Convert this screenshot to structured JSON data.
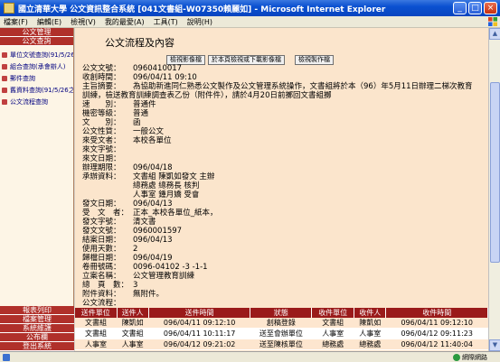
{
  "window": {
    "title": "國立清華大學 公文資訊整合系統 [041文書組-W07350賴麗如] - Microsoft Internet Explorer"
  },
  "menu": [
    "檔案(F)",
    "編輯(E)",
    "檢視(V)",
    "我的最愛(A)",
    "工具(T)",
    "說明(H)"
  ],
  "sidebar": {
    "top_headers": [
      "公文管理",
      "公文查詢"
    ],
    "items": [
      "單位文號查詢(91/5/26之前)",
      "組合查詢(承會辦人)",
      "郵件查詢",
      "舊資料查詢(91/5/26之前)",
      "公文流程查詢"
    ],
    "bottom_headers": [
      "報表列印",
      "檔案管理",
      "系統維護",
      "公布欄",
      "登出系統"
    ]
  },
  "main": {
    "title": "公文流程及內容",
    "buttons": [
      "檢視影像檔",
      "於本頁檢視或下載影像檔",
      "檢視製作檔"
    ],
    "fields": {
      "doc_no_label": "公文文號：",
      "doc_no": "0960410017",
      "received_label": "收創時間：",
      "received": "096/04/11 09:10",
      "subject_label": "主旨摘要：",
      "subject": "為協助新進同仁熟悉公文製作及公文管理系統操作，文書組將於本（96）年5月11日辦理二梯次教育訓練，檢送教育訓練調查表乙份（附件件），請於4月20日前擲回文書組擲",
      "speed_label": "速　　別：",
      "speed": "普通件",
      "secret_label": "機密等級：",
      "secret": "普通",
      "type_label": "文　　別：",
      "type": "函",
      "nature_label": "公文性質：",
      "nature": "一般公文",
      "sender_label": "來受文者：",
      "sender": "本校各單位",
      "incoming_label": "來文字號：",
      "incoming": "",
      "incoming_date_label": "來文日期：",
      "incoming_date": "",
      "deadline_label": "辦理期限：",
      "deadline": "096/04/18",
      "handler_label": "承辦資料：",
      "handler_lines": [
        "文書組 陳凱如發文 主辦",
        "總務處 總務長 核判",
        "人事室 鍾月嬌 受會"
      ],
      "issue_date_label": "發文日期：",
      "issue_date": "096/04/13",
      "recipient_label": "受　文　者：",
      "recipient": "正本_本校各單位_紙本，",
      "issue_word_label": "發文字號：",
      "issue_word": "清文書",
      "issue_no_label": "發文文號：",
      "issue_no": "0960001597",
      "close_date_label": "結案日期：",
      "close_date": "096/04/13",
      "use_days_label": "使用天數：",
      "use_days": "2",
      "archive_date_label": "歸檔日期：",
      "archive_date": "096/04/19",
      "file_no_label": "卷冊號碼：",
      "file_no": "0096-04102 -3 -1-1",
      "case_label": "立案名稱：",
      "case": "公文管理教育訓練",
      "pages_label": "總　頁　數：",
      "pages": "3",
      "attach_label": "附件資料：",
      "attach": "無附件。",
      "flow_label": "公文流程："
    },
    "table": {
      "headers": [
        "送件單位",
        "送件人",
        "送件時間",
        "狀態",
        "收件單位",
        "收件人",
        "收件時間"
      ],
      "rows": [
        [
          "文書組",
          "陳凱如",
          "096/04/11 09:12:10",
          "創稿登錄",
          "文書組",
          "陳凱如",
          "096/04/11 09:12:10"
        ],
        [
          "文書組",
          "文書組",
          "096/04/11 10:11:17",
          "送至會辦單位",
          "人事室",
          "人事室",
          "096/04/12 09:11:23"
        ],
        [
          "人事室",
          "人事室",
          "096/04/12 09:21:02",
          "送至陳核單位",
          "總務處",
          "總務處",
          "096/04/12 11:40:04"
        ]
      ]
    }
  },
  "statusbar": {
    "zone": "網際網路"
  }
}
